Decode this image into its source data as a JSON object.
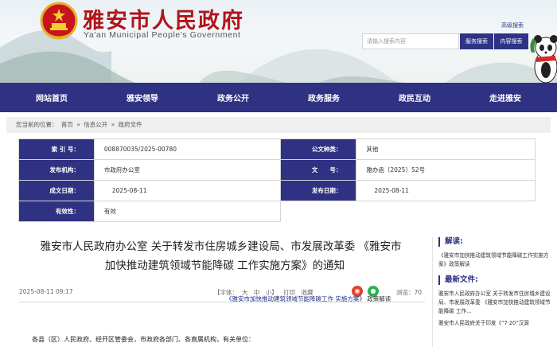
{
  "header": {
    "site_title_cn": "雅安市人民政府",
    "site_title_en": "Ya'an Municipal People's Government",
    "advanced_search": "高级搜索",
    "search_placeholder": "请输入搜索内容",
    "search_btn": "服务搜索",
    "content_search_btn": "内容搜索"
  },
  "nav": [
    "网站首页",
    "雅安领导",
    "政务公开",
    "政务服务",
    "政民互动",
    "走进雅安"
  ],
  "breadcrumb": {
    "prefix": "您当前的位置：",
    "items": [
      "首页",
      "信息公开",
      "政府文件"
    ],
    "sep": "»"
  },
  "meta": {
    "index_label": "索 引 号：",
    "index_value": "008870035/2025-00780",
    "category_label": "公文种类：",
    "category_value": "其他",
    "issuer_label": "发布机构：",
    "issuer_value": "市政府办公室",
    "docno_label": "文　　号：",
    "docno_value": "雅办函〔2025〕52号",
    "written_label": "成文日期：",
    "written_value": "2025-08-11",
    "published_label": "发布日期：",
    "published_value": "2025-08-11",
    "validity_label": "有效性：",
    "validity_value": "有效"
  },
  "article": {
    "title_line1": "雅安市人民政府办公室 关于转发市住房城乡建设局、市发展改革委 《雅安市",
    "title_line2": "加快推动建筑领域节能降碳 工作实施方案》的通知",
    "date": "2025-08-11 09:17",
    "font_label": "【字体：",
    "font_large": "大",
    "font_medium": "中",
    "font_small": "小】",
    "print": "打印",
    "favorite": "收藏",
    "views": "浏览：70",
    "policy_link": "《雅安市加快推动建筑领域节能降碳工作 实施方案》",
    "policy_suffix": "政策解读",
    "body_first_line": "各县（区）人民政府、经开区管委会，市政府各部门、各直属机构，有关单位："
  },
  "sidebar": {
    "interpret_heading": "解读:",
    "interpret_link": "《雅安市加快推动建筑领域节能降碳工作实施方案》政策解读",
    "latest_heading": "最新文件:",
    "latest_1": "雅安市人民政府办公室 关于转发市住房城乡建设局、市发展改革委 《雅安市加快推动建筑领域节能降碳 工作...",
    "latest_2": "雅安市人民政府关于印发《“7·20”汉源"
  },
  "colors": {
    "nav_bg": "#2f3182",
    "title_red": "#b1141b",
    "link_blue": "#1c2d8a"
  }
}
